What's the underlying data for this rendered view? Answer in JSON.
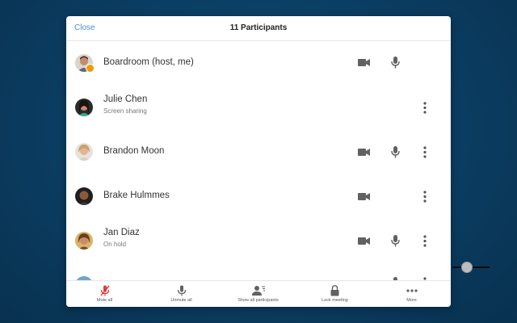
{
  "header": {
    "close_label": "Close",
    "title": "11 Participants"
  },
  "participants": [
    {
      "name": "Boardroom (host, me)",
      "status": "",
      "camera": true,
      "mic": true,
      "more": false
    },
    {
      "name": "Julie Chen",
      "status": "Screen sharing",
      "camera": false,
      "mic": false,
      "more": true
    },
    {
      "name": "Brandon Moon",
      "status": "",
      "camera": true,
      "mic": true,
      "more": true
    },
    {
      "name": "Brake Hulmmes",
      "status": "",
      "camera": true,
      "mic": false,
      "more": true
    },
    {
      "name": "Jan Diaz",
      "status": "On hold",
      "camera": true,
      "mic": true,
      "more": true
    }
  ],
  "footer": {
    "mute_all": "Mute all",
    "unmute_all": "Unmute all",
    "show_all": "Show all participants",
    "lock_meeting": "Lock meeting",
    "more": "More"
  },
  "colors": {
    "accent": "#4a90d9",
    "icon": "#616161",
    "mute_red": "#e53935",
    "host_badge": "#f29900"
  }
}
